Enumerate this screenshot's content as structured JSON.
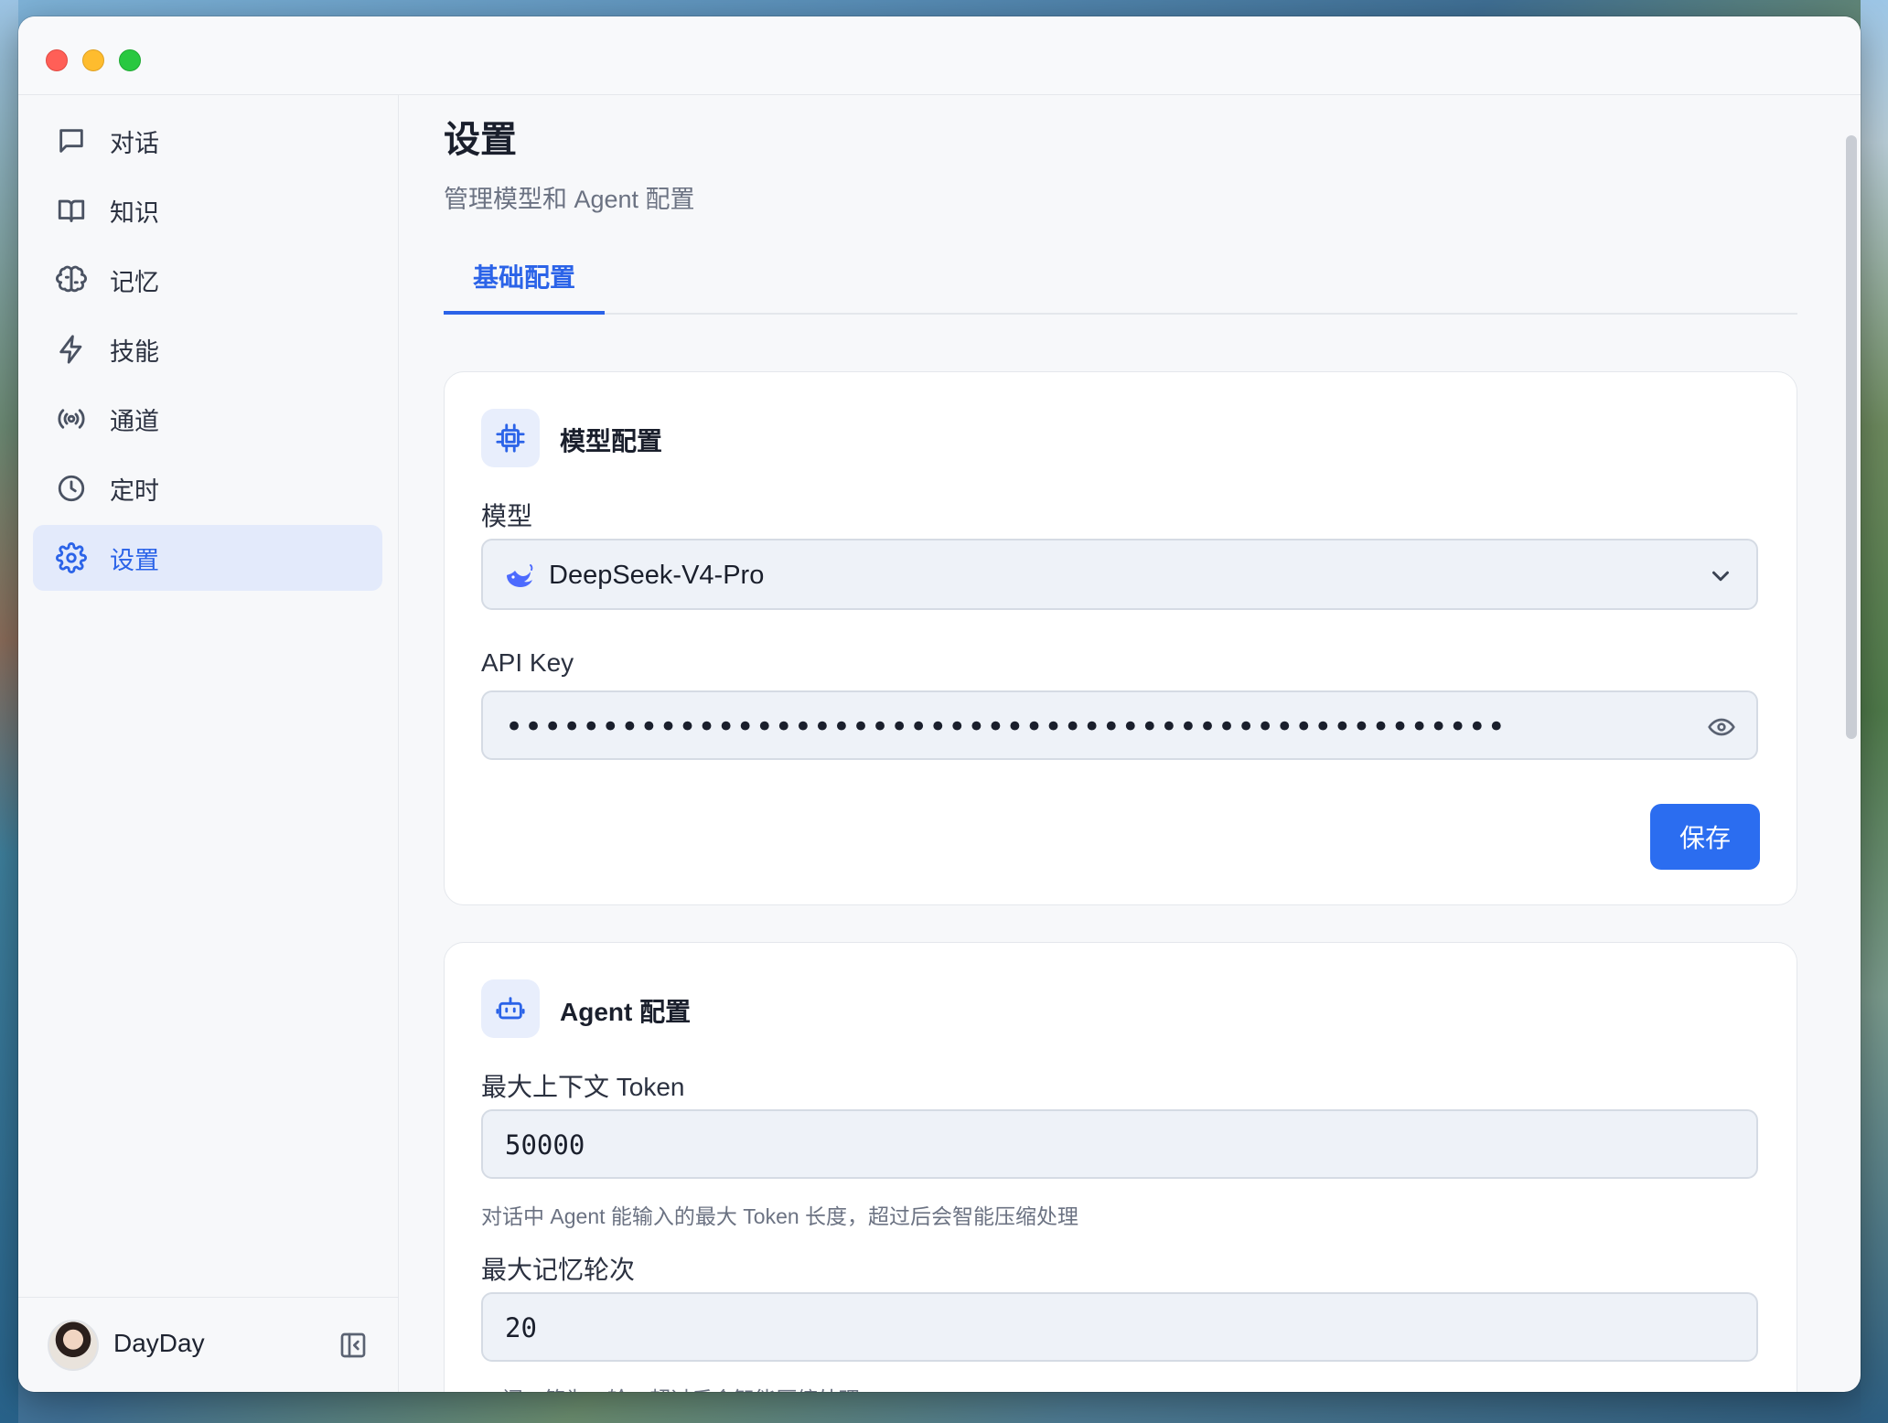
{
  "sidebar": {
    "items": [
      {
        "label": "对话",
        "icon": "chat-icon"
      },
      {
        "label": "知识",
        "icon": "book-icon"
      },
      {
        "label": "记忆",
        "icon": "brain-icon"
      },
      {
        "label": "技能",
        "icon": "lightning-icon"
      },
      {
        "label": "通道",
        "icon": "broadcast-icon"
      },
      {
        "label": "定时",
        "icon": "clock-icon"
      },
      {
        "label": "设置",
        "icon": "gear-icon",
        "active": true
      }
    ],
    "user": {
      "name": "DayDay"
    }
  },
  "main": {
    "title": "设置",
    "subtitle": "管理模型和 Agent 配置",
    "tabs": [
      {
        "label": "基础配置",
        "active": true
      }
    ],
    "model_card": {
      "title": "模型配置",
      "model_label": "模型",
      "model_value": "DeepSeek-V4-Pro",
      "api_key_label": "API Key",
      "api_key_value": "••••••••••••••••••••••••••••••••••••••••••••••••••••",
      "save_label": "保存"
    },
    "agent_card": {
      "title": "Agent 配置",
      "max_token_label": "最大上下文 Token",
      "max_token_value": "50000",
      "max_token_hint": "对话中 Agent 能输入的最大 Token 长度，超过后会智能压缩处理",
      "max_rounds_label": "最大记忆轮次",
      "max_rounds_value": "20",
      "max_rounds_hint": "一问一答为一轮，超过后会智能压缩处理"
    }
  },
  "colors": {
    "accent": "#2b63e8",
    "active_bg": "#e3eafb",
    "field_bg": "#eef2f8"
  }
}
